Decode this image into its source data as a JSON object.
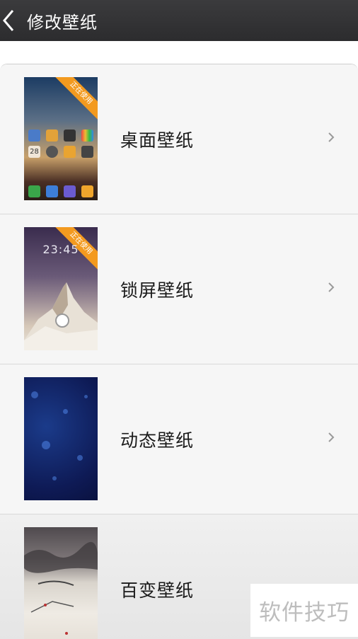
{
  "header": {
    "title": "修改壁纸"
  },
  "ribbon": "正在使用",
  "rows": [
    {
      "label": "桌面壁纸"
    },
    {
      "label": "锁屏壁纸"
    },
    {
      "label": "动态壁纸"
    },
    {
      "label": "百变壁纸"
    }
  ],
  "home_preview": {
    "calendar_day": "28"
  },
  "lock_preview": {
    "time": "23:45"
  },
  "watermark": "软件技巧",
  "icons": [
    "back-arrow-icon",
    "chevron-right-icon",
    "lock-icon",
    "phone-icon",
    "contacts-icon",
    "browser-icon",
    "messages-icon"
  ]
}
